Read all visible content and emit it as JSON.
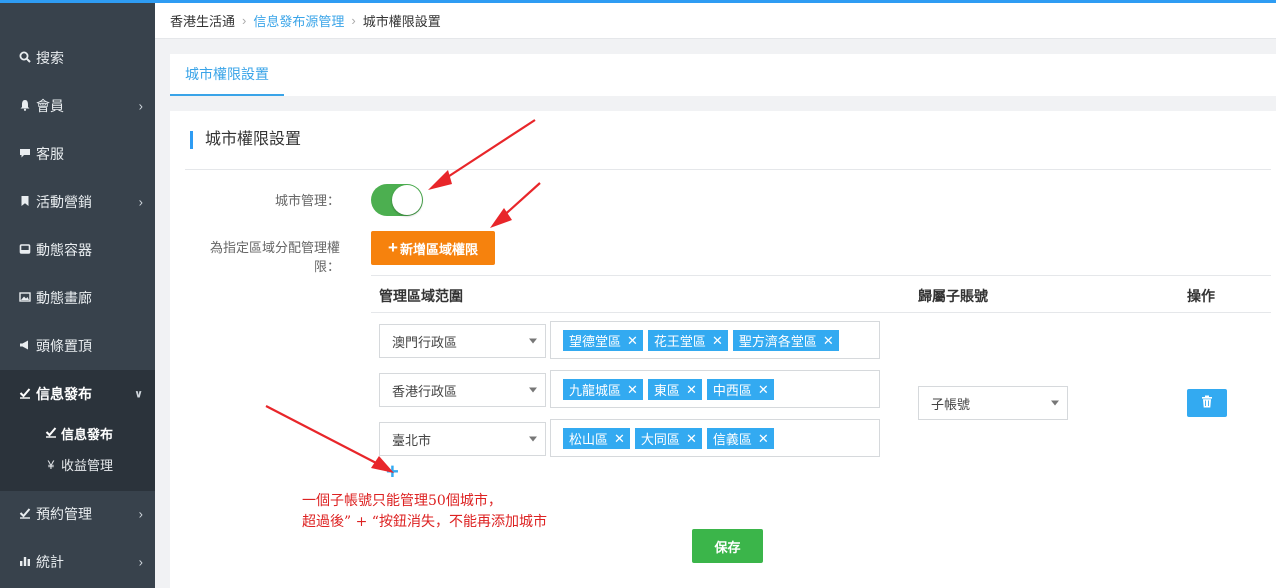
{
  "breadcrumb": {
    "home": "香港生活通",
    "parent": "信息發布源管理",
    "current": "城市權限設置"
  },
  "sidebar": {
    "items": [
      {
        "label": "搜索",
        "icon": "search-icon"
      },
      {
        "label": "會員",
        "icon": "bell-icon"
      },
      {
        "label": "客服",
        "icon": "chat-icon"
      },
      {
        "label": "活動營銷",
        "icon": "bookmark-icon"
      },
      {
        "label": "動態容器",
        "icon": "hdd-icon"
      },
      {
        "label": "動態畫廊",
        "icon": "image-icon"
      },
      {
        "label": "頭條置頂",
        "icon": "bullhorn-icon"
      },
      {
        "label": "信息發布",
        "icon": "check-icon"
      },
      {
        "label": "預約管理",
        "icon": "check-icon"
      },
      {
        "label": "統計",
        "icon": "bar-chart-icon"
      }
    ],
    "subitems": [
      {
        "label": "信息發布",
        "icon": "check-icon"
      },
      {
        "label": "收益管理",
        "icon": "yen-icon"
      }
    ]
  },
  "tabs": [
    {
      "label": "城市權限設置"
    }
  ],
  "panel": {
    "title": "城市權限設置",
    "city_manage_label": "城市管理：",
    "assign_label_1": "為指定區域分配管理權",
    "assign_label_2": "限：",
    "toggle_on": true,
    "add_button": "新增區域權限",
    "table": {
      "headers": {
        "scope": "管理區域范圍",
        "account": "歸屬子賬號",
        "action": "操作"
      },
      "rows": [
        {
          "region": "澳門行政區",
          "tags": [
            "望德堂區",
            "花王堂區",
            "聖方濟各堂區"
          ]
        },
        {
          "region": "香港行政區",
          "tags": [
            "九龍城區",
            "東區",
            "中西區"
          ]
        },
        {
          "region": "臺北市",
          "tags": [
            "松山區",
            "大同區",
            "信義區"
          ]
        }
      ],
      "account_select": "子帳號"
    },
    "add_plus": "+",
    "note_line1": "一個子帳號只能管理50個城市，",
    "note_line2": "超過後” + “按鈕消失，不能再添加城市",
    "save_button": "保存"
  },
  "colors": {
    "accent": "#2e9cf3",
    "tag": "#33aaf1",
    "orange": "#f6820d",
    "green": "#3bb54a",
    "sidebar": "#38424c",
    "arrow": "#e8262a"
  }
}
